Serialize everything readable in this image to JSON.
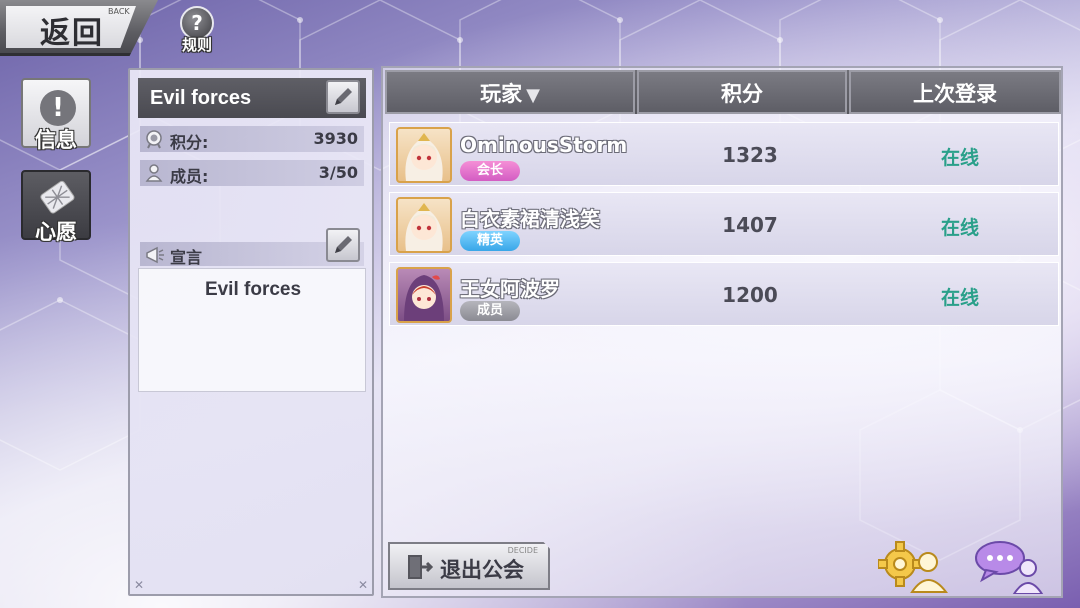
{
  "nav": {
    "back_label": "返回",
    "back_sub": "BACK",
    "rules_label": "规则",
    "rules_icon_glyph": "?"
  },
  "side_tabs": [
    {
      "label": "信息",
      "icon": "alert-icon",
      "active": true
    },
    {
      "label": "心愿",
      "icon": "scroll-icon",
      "active": false
    }
  ],
  "guild": {
    "name": "Evil forces",
    "score_label": "积分:",
    "score_value": "3930",
    "members_label": "成员:",
    "members_value": "3/50",
    "declaration_label": "宣言",
    "declaration_text": "Evil forces"
  },
  "table": {
    "headers": {
      "player": "玩家",
      "score": "积分",
      "last_login": "上次登录"
    },
    "sort_indicator": "arrow-down",
    "rows": [
      {
        "name": "OminousStorm",
        "role": "会长",
        "role_type": "leader",
        "score": "1323",
        "status": "在线"
      },
      {
        "name": "白衣素裙清浅笑",
        "role": "精英",
        "role_type": "elite",
        "score": "1407",
        "status": "在线"
      },
      {
        "name": "王女阿波罗",
        "role": "成员",
        "role_type": "member",
        "score": "1200",
        "status": "在线"
      }
    ]
  },
  "footer": {
    "quit_label": "退出公会",
    "quit_sub": "DECIDE"
  },
  "colors": {
    "online": "#2aa08a",
    "leader_badge": "#e27ad0",
    "elite_badge": "#4fb8f2",
    "member_badge": "#9f9fa7"
  }
}
